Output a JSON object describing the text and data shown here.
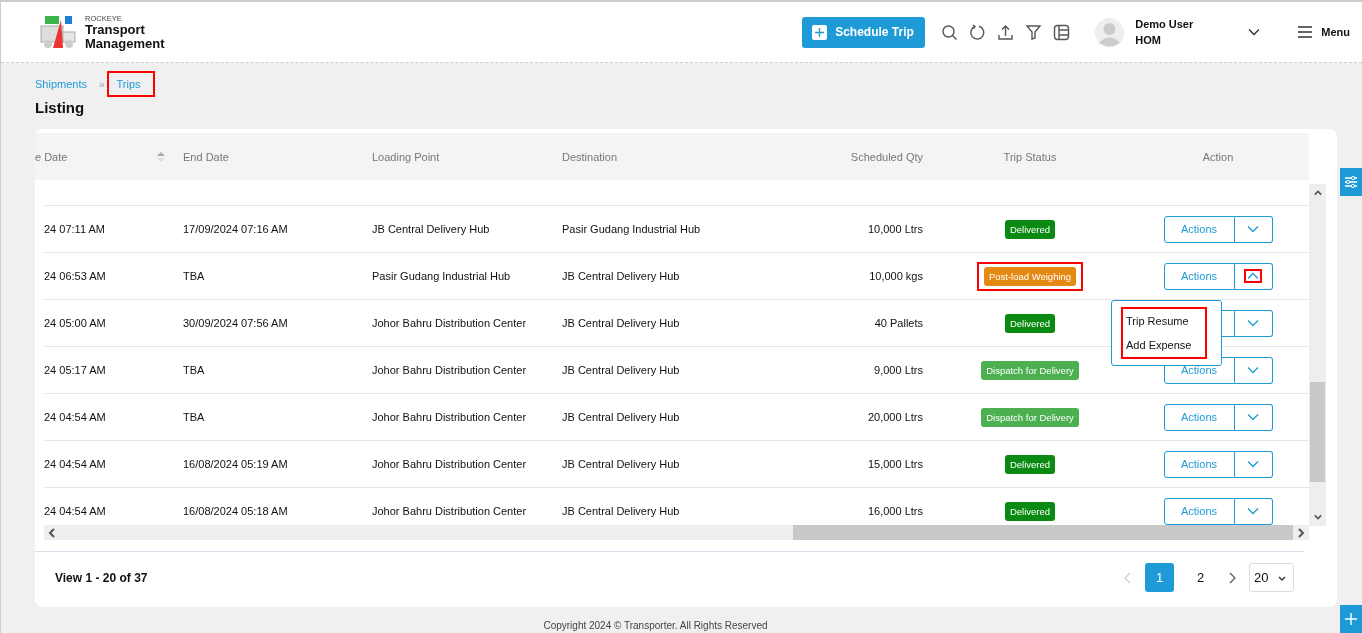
{
  "header": {
    "brand_top": "ROCKEYE",
    "brand_line1": "Transport",
    "brand_line2": "Management",
    "schedule_button": "Schedule Trip",
    "user_name": "Demo User",
    "user_role": "HOM",
    "menu_label": "Menu"
  },
  "breadcrumb": [
    {
      "label": "Shipments",
      "highlighted": false
    },
    {
      "label": "Trips",
      "highlighted": true
    }
  ],
  "breadcrumb_separator": "»",
  "page_title": "Listing",
  "table": {
    "columns": [
      {
        "label": "e Date",
        "sortable": true
      },
      {
        "label": "End Date"
      },
      {
        "label": "Loading Point"
      },
      {
        "label": "Destination"
      },
      {
        "label": "Scheduled Qty"
      },
      {
        "label": "Trip Status"
      },
      {
        "label": "Action"
      }
    ],
    "rows": [
      {
        "cells": [
          "24 07:11 AM",
          "17/09/2024 07:16 AM",
          "JB Central Delivery Hub",
          "Pasir Gudang Industrial Hub",
          "10,000 Ltrs"
        ],
        "status": {
          "label": "Delivered",
          "kind": "delivered",
          "highlighted": false
        },
        "action": {
          "label": "Actions",
          "expanded": false,
          "highlighted": false
        }
      },
      {
        "cells": [
          "24 06:53 AM",
          "TBA",
          "Pasir Gudang Industrial Hub",
          "JB Central Delivery Hub",
          "10,000 kgs"
        ],
        "status": {
          "label": "Post-load Weighing",
          "kind": "weighing",
          "highlighted": true
        },
        "action": {
          "label": "Actions",
          "expanded": true,
          "highlighted": true
        }
      },
      {
        "cells": [
          "24 05:00 AM",
          "30/09/2024 07:56 AM",
          "Johor Bahru Distribution Center",
          "JB Central Delivery Hub",
          "40 Pallets"
        ],
        "status": {
          "label": "Delivered",
          "kind": "delivered",
          "highlighted": false
        },
        "action": {
          "expanded": false,
          "highlighted": false
        }
      },
      {
        "cells": [
          "24 05:17 AM",
          "TBA",
          "Johor Bahru Distribution Center",
          "JB Central Delivery Hub",
          "9,000 Ltrs"
        ],
        "status": {
          "label": "Dispatch for Delivery",
          "kind": "dispatch",
          "highlighted": false
        },
        "action": {
          "label": "Actions",
          "expanded": false,
          "highlighted": false
        }
      },
      {
        "cells": [
          "24 04:54 AM",
          "TBA",
          "Johor Bahru Distribution Center",
          "JB Central Delivery Hub",
          "20,000 Ltrs"
        ],
        "status": {
          "label": "Dispatch for Delivery",
          "kind": "dispatch",
          "highlighted": false
        },
        "action": {
          "label": "Actions",
          "expanded": false,
          "highlighted": false
        }
      },
      {
        "cells": [
          "24 04:54 AM",
          "16/08/2024 05:19 AM",
          "Johor Bahru Distribution Center",
          "JB Central Delivery Hub",
          "15,000 Ltrs"
        ],
        "status": {
          "label": "Delivered",
          "kind": "delivered",
          "highlighted": false
        },
        "action": {
          "label": "Actions",
          "expanded": false,
          "highlighted": false
        }
      },
      {
        "cells": [
          "24 04:54 AM",
          "16/08/2024 05:18 AM",
          "Johor Bahru Distribution Center",
          "JB Central Delivery Hub",
          "16,000 Ltrs"
        ],
        "status": {
          "label": "Delivered",
          "kind": "delivered",
          "highlighted": false
        },
        "action": {
          "label": "Actions",
          "expanded": false,
          "highlighted": false
        }
      }
    ],
    "dropdown": {
      "items": [
        {
          "label": "Trip Resume"
        },
        {
          "label": "Add Expense"
        }
      ],
      "highlighted": true
    }
  },
  "pager": {
    "summary": "View 1 - 20 of 37",
    "prev_disabled": true,
    "pages": [
      {
        "label": "1",
        "selected": true
      },
      {
        "label": "2",
        "selected": false
      }
    ],
    "page_size": "20"
  },
  "footer": "Copyright 2024 © Transporter. All Rights Reserved"
}
